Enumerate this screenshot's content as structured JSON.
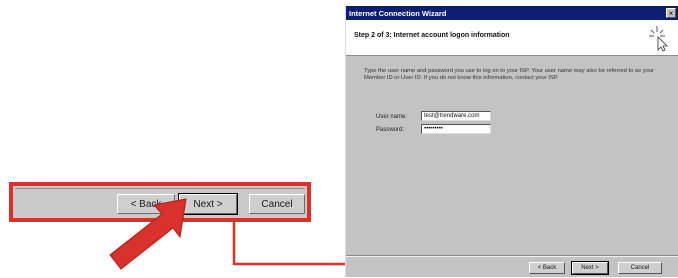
{
  "zoom_panel": {
    "back_label": "< Back",
    "next_label": "Next >",
    "cancel_label": "Cancel"
  },
  "wizard": {
    "window_title": "Internet Connection Wizard",
    "step_title": "Step 2 of 3: Internet account logon information",
    "instructions": "Type the user name and password you use to log on to your ISP. Your user name may also be referred to as your Member ID or User ID. If you do not know this information, contact your ISP.",
    "username_label": "User name:",
    "username_value": "test@trendware.com",
    "password_label": "Password:",
    "password_value": "•••••••••",
    "back_label": "< Back",
    "next_label": "Next >",
    "cancel_label": "Cancel"
  },
  "colors": {
    "highlight_red": "#d9312b",
    "titlebar_blue": "#0d1f73"
  }
}
